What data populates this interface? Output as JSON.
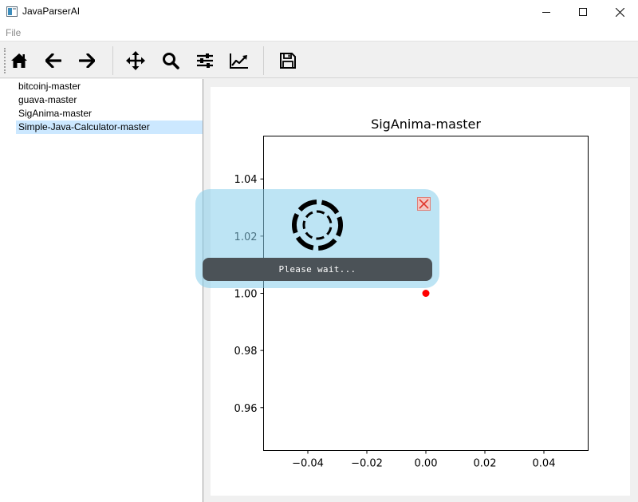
{
  "window": {
    "title": "JavaParserAI",
    "controls": {
      "minimize": "minimize-icon",
      "maximize": "maximize-icon",
      "close": "close-icon"
    }
  },
  "menubar": {
    "file_label": "File"
  },
  "toolbar": {
    "buttons": [
      {
        "name": "home",
        "icon": "home-icon"
      },
      {
        "name": "back",
        "icon": "arrow-left-icon"
      },
      {
        "name": "forward",
        "icon": "arrow-right-icon"
      },
      {
        "name": "pan",
        "icon": "move-icon"
      },
      {
        "name": "zoom",
        "icon": "zoom-icon"
      },
      {
        "name": "subplots",
        "icon": "sliders-icon"
      },
      {
        "name": "axes",
        "icon": "line-chart-icon"
      },
      {
        "name": "save",
        "icon": "save-icon"
      }
    ]
  },
  "repo_list": {
    "items": [
      {
        "label": "bitcoinj-master",
        "selected": false
      },
      {
        "label": "guava-master",
        "selected": false
      },
      {
        "label": "SigAnima-master",
        "selected": false
      },
      {
        "label": "Simple-Java-Calculator-master",
        "selected": true
      }
    ]
  },
  "chart_data": {
    "type": "scatter",
    "title": "SigAnima-master",
    "xlabel": "",
    "ylabel": "",
    "xlim": [
      -0.055,
      0.055
    ],
    "ylim": [
      0.945,
      1.055
    ],
    "xticks": [
      -0.04,
      -0.02,
      0.0,
      0.02,
      0.04
    ],
    "xtick_labels": [
      "−0.04",
      "−0.02",
      "0.00",
      "0.02",
      "0.04"
    ],
    "yticks": [
      0.96,
      0.98,
      1.0,
      1.02,
      1.04
    ],
    "ytick_labels": [
      "0.96",
      "0.98",
      "1.00",
      "1.02",
      "1.04"
    ],
    "grid": false,
    "points": [
      {
        "x": 0.0,
        "y": 1.0
      }
    ],
    "point_color": "#ff0000"
  },
  "overlay": {
    "message": "Please wait...",
    "spinner_icon": "loading-spinner-icon",
    "close_icon": "close-icon",
    "background_color": "#87ceeb"
  }
}
